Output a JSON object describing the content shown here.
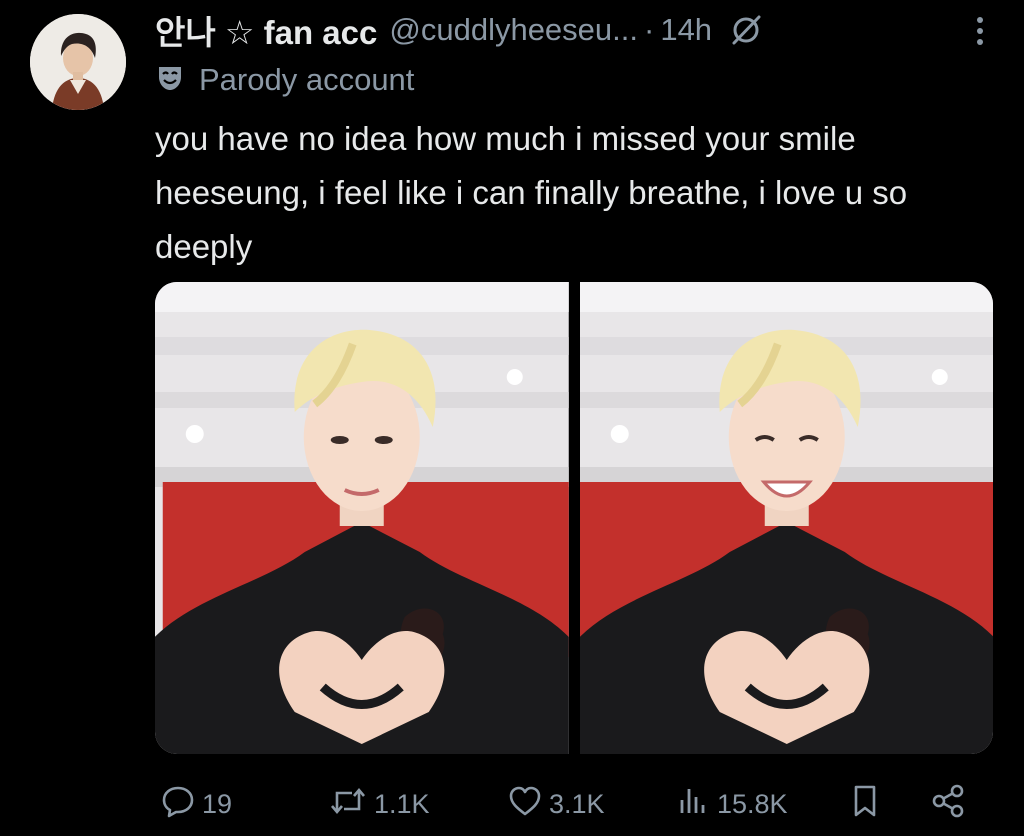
{
  "user": {
    "display_name": "안나 ☆ fan acc",
    "handle": "@cuddlyheeseu...",
    "separator": "·",
    "time": "14h",
    "label": "Parody account"
  },
  "tweet": {
    "text": "you have no idea how much i missed your smile heeseung, i feel like i can finally breathe, i love u so deeply"
  },
  "stats": {
    "replies": "19",
    "retweets": "1.1K",
    "likes": "3.1K",
    "views": "15.8K"
  },
  "icons": {
    "header": [
      "grok-slash-icon",
      "more-icon",
      "parody-mask-icon"
    ],
    "actions": [
      "reply-icon",
      "retweet-icon",
      "like-icon",
      "views-icon",
      "bookmark-icon",
      "share-icon"
    ]
  },
  "colors": {
    "background": "#000000",
    "primary_text": "#e7e9ea",
    "secondary_text": "#8b98a5"
  }
}
